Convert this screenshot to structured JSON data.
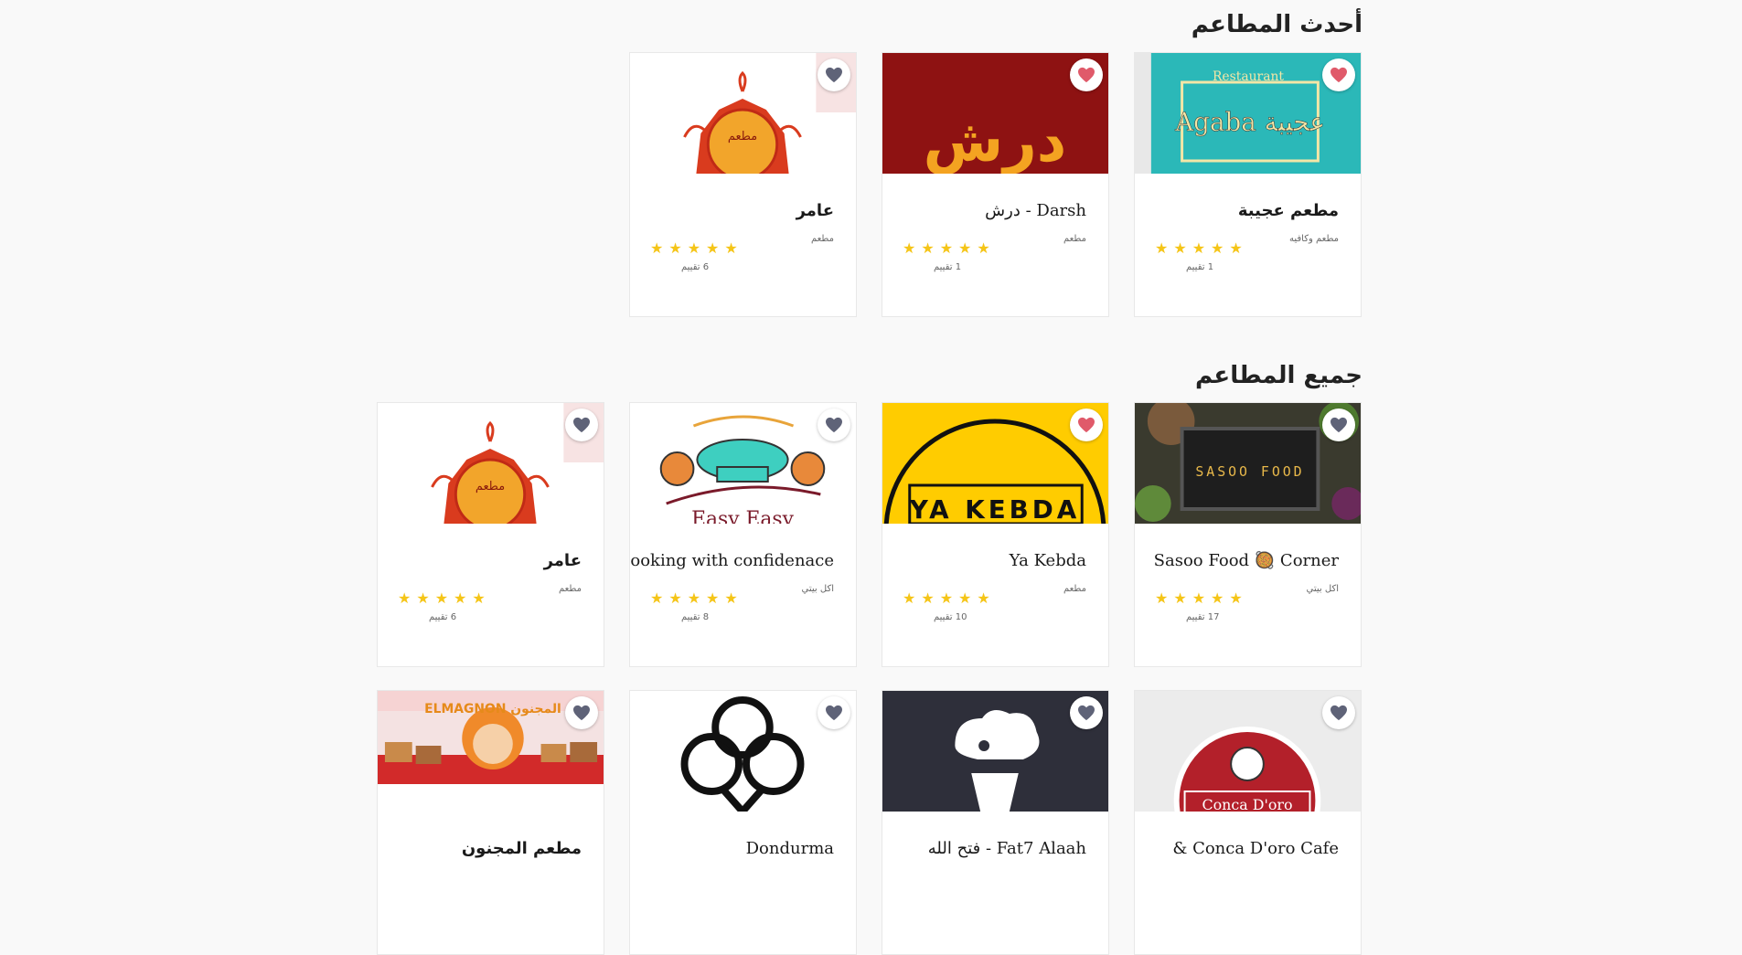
{
  "sections": {
    "latest_title": "أحدث المطاعم",
    "all_title": "جميع المطاعم"
  },
  "colors": {
    "heart_active": "#e05a6a",
    "heart_inactive": "#5f6378",
    "star": "#f5c518"
  },
  "latest": [
    {
      "name": "مطعم عجيبة",
      "category": "مطعم وكافيه",
      "stars": "★★★★★",
      "reviews": "1 تقييم",
      "favorited": true,
      "image_logo_text": "Agaba عجيبة",
      "image_arc_text": "Restaurant"
    },
    {
      "name": "Darsh - درش",
      "category": "مطعم",
      "stars": "★★★★★",
      "reviews": "1 تقييم",
      "favorited": true,
      "image_logo_text": "درش"
    },
    {
      "name": "عامر",
      "category": "مطعم",
      "stars": "★★★★★",
      "reviews": "6 تقييم",
      "favorited": false,
      "image_logo_text": "مطعم"
    }
  ],
  "all": [
    {
      "name": "Sasoo Food 🥘 Corner",
      "category": "اكل بيتي",
      "stars": "★★★★★",
      "reviews": "17 تقييم",
      "favorited": false,
      "image_logo_text": "SASOO FOOD"
    },
    {
      "name": "Ya Kebda",
      "category": "مطعم",
      "stars": "★★★★★",
      "reviews": "10 تقييم",
      "favorited": true,
      "image_logo_text": "YA KEBDA"
    },
    {
      "name": "cooking with confidenace",
      "category": "اكل بيتي",
      "stars": "★★★★★",
      "reviews": "8 تقييم",
      "favorited": false,
      "image_logo_text": "Easy Easy"
    },
    {
      "name": "عامر",
      "category": "مطعم",
      "stars": "★★★★★",
      "reviews": "6 تقييم",
      "favorited": false,
      "image_logo_text": "مطعم"
    },
    {
      "name": "Conca D'oro Cafe &",
      "favorited": false,
      "image_logo_text": "Conca D'oro"
    },
    {
      "name": "Fat7 Alaah - فتح الله",
      "favorited": false
    },
    {
      "name": "Dondurma",
      "favorited": false
    },
    {
      "name": "مطعم المجنون",
      "favorited": false,
      "image_logo_text": "ELMAGNON المجنون"
    }
  ]
}
